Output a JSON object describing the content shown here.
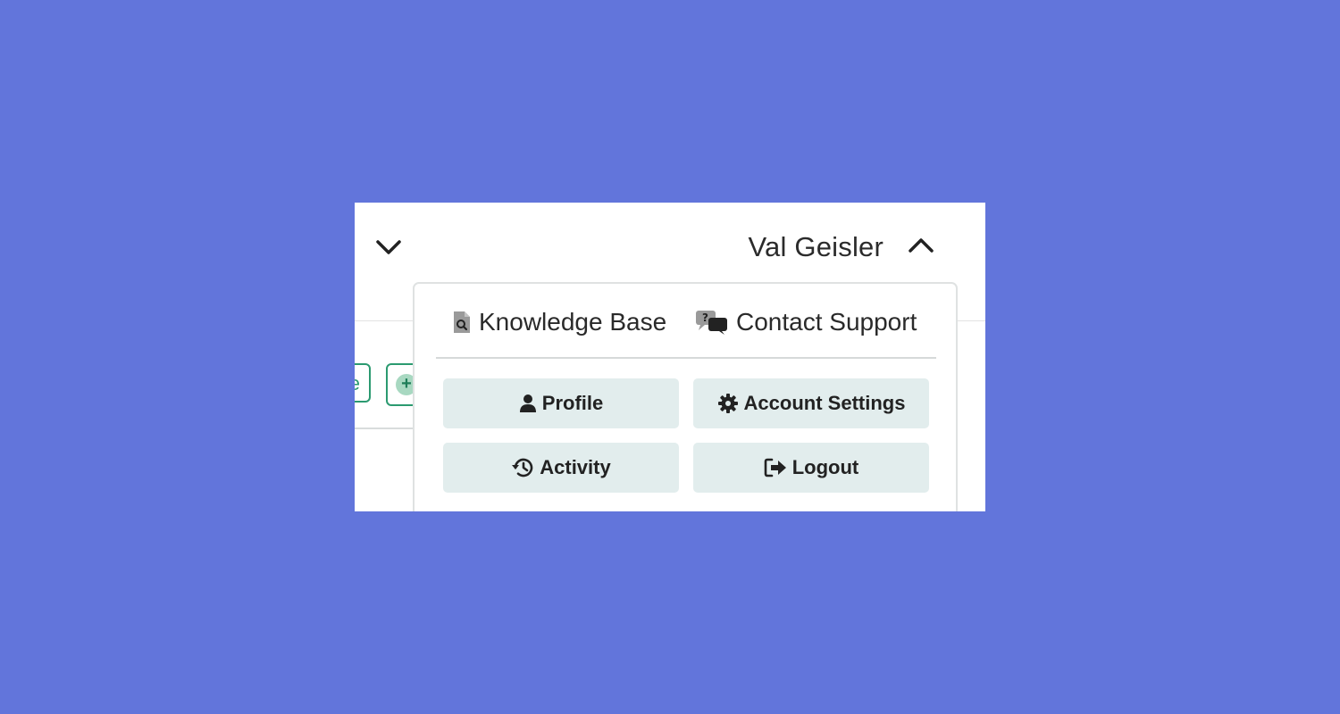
{
  "header": {
    "user_name": "Val Geisler",
    "left_toggle_icon": "chevron-down-icon",
    "user_toggle_icon": "chevron-up-icon"
  },
  "background_toolbar": {
    "partial_button_text": "e",
    "add_button_icon": "plus-circle-icon",
    "add_button_symbol": "+"
  },
  "user_menu": {
    "top_links": [
      {
        "label": "Knowledge Base",
        "icon": "document-search-icon"
      },
      {
        "label": "Contact Support",
        "icon": "chat-question-icon"
      }
    ],
    "actions": [
      {
        "label": "Profile",
        "icon": "user-icon"
      },
      {
        "label": "Account Settings",
        "icon": "gear-icon"
      },
      {
        "label": "Activity",
        "icon": "history-icon"
      },
      {
        "label": "Logout",
        "icon": "logout-icon"
      }
    ]
  },
  "colors": {
    "page_background": "#6275db",
    "panel_background": "#ffffff",
    "button_background": "#e2eded",
    "accent_green": "#2b9a70",
    "text": "#2a2a2a"
  }
}
